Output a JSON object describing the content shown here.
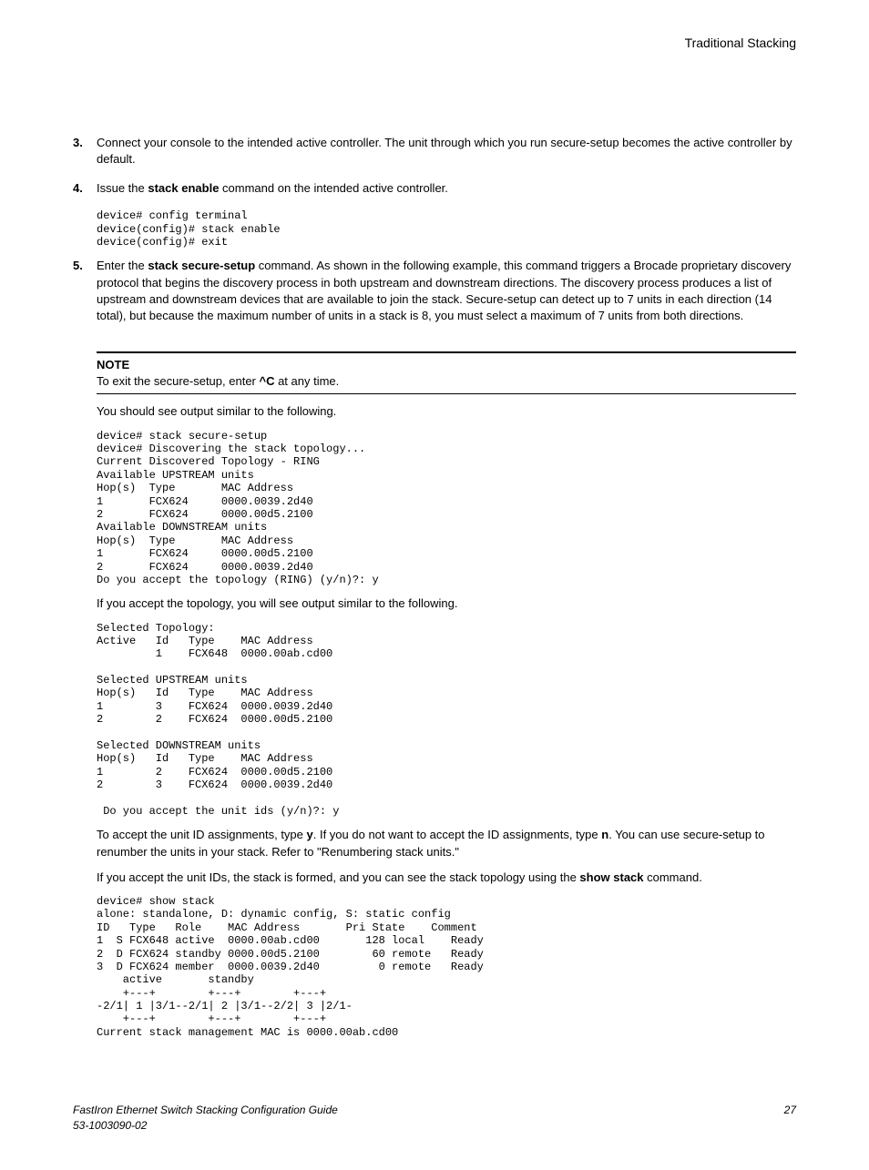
{
  "header": {
    "right": "Traditional Stacking"
  },
  "items": {
    "item3": {
      "num": "3.",
      "text": "Connect your console to the intended active controller. The unit through which you run secure-setup becomes the active controller by default."
    },
    "item4": {
      "num": "4.",
      "text_a": "Issue the ",
      "bold": "stack enable",
      "text_b": " command on the intended active controller."
    },
    "item5": {
      "num": "5.",
      "text_a": "Enter the ",
      "bold": "stack secure-setup",
      "text_b": " command. As shown in the following example, this command triggers a Brocade proprietary discovery protocol that begins the discovery process in both upstream and downstream directions. The discovery process produces a list of upstream and downstream devices that are available to join the stack. Secure-setup can detect up to 7 units in each direction (14 total), but because the maximum number of units in a stack is 8, you must select a maximum of 7 units from both directions."
    }
  },
  "code1": "device# config terminal\ndevice(config)# stack enable\ndevice(config)# exit",
  "note": {
    "label": "NOTE",
    "text_a": "To exit the secure-setup, enter ",
    "bold": "^C",
    "text_b": " at any time."
  },
  "para1": "You should see output similar to the following.",
  "code2": "device# stack secure-setup\ndevice# Discovering the stack topology...\nCurrent Discovered Topology - RING\nAvailable UPSTREAM units\nHop(s)  Type       MAC Address\n1       FCX624     0000.0039.2d40\n2       FCX624     0000.00d5.2100\nAvailable DOWNSTREAM units\nHop(s)  Type       MAC Address\n1       FCX624     0000.00d5.2100\n2       FCX624     0000.0039.2d40\nDo you accept the topology (RING) (y/n)?: y",
  "para2": "If you accept the topology, you will see output similar to the following.",
  "code3": "Selected Topology:\nActive   Id   Type    MAC Address\n         1    FCX648  0000.00ab.cd00\n\nSelected UPSTREAM units\nHop(s)   Id   Type    MAC Address\n1        3    FCX624  0000.0039.2d40\n2        2    FCX624  0000.00d5.2100\n\nSelected DOWNSTREAM units\nHop(s)   Id   Type    MAC Address\n1        2    FCX624  0000.00d5.2100\n2        3    FCX624  0000.0039.2d40\n\n Do you accept the unit ids (y/n)?: y",
  "para3": {
    "a": "To accept the unit ID assignments, type ",
    "b": "y",
    "c": ". If you do not want to accept the ID assignments, type ",
    "d": "n",
    "e": ". You can use secure-setup to renumber the units in your stack. Refer to \"Renumbering stack units.\""
  },
  "para4": {
    "a": "If you accept the unit IDs, the stack is formed, and you can see the stack topology using the ",
    "b": "show stack",
    "c": " command."
  },
  "code4": "device# show stack\nalone: standalone, D: dynamic config, S: static config\nID   Type   Role    MAC Address       Pri State    Comment\n1  S FCX648 active  0000.00ab.cd00       128 local    Ready\n2  D FCX624 standby 0000.00d5.2100        60 remote   Ready\n3  D FCX624 member  0000.0039.2d40         0 remote   Ready\n    active       standby\n    +---+        +---+        +---+\n-2/1| 1 |3/1--2/1| 2 |3/1--2/2| 3 |2/1-\n    +---+        +---+        +---+\nCurrent stack management MAC is 0000.00ab.cd00",
  "footer": {
    "line1": "FastIron Ethernet Switch Stacking Configuration Guide",
    "line2": "53-1003090-02",
    "page": "27"
  }
}
